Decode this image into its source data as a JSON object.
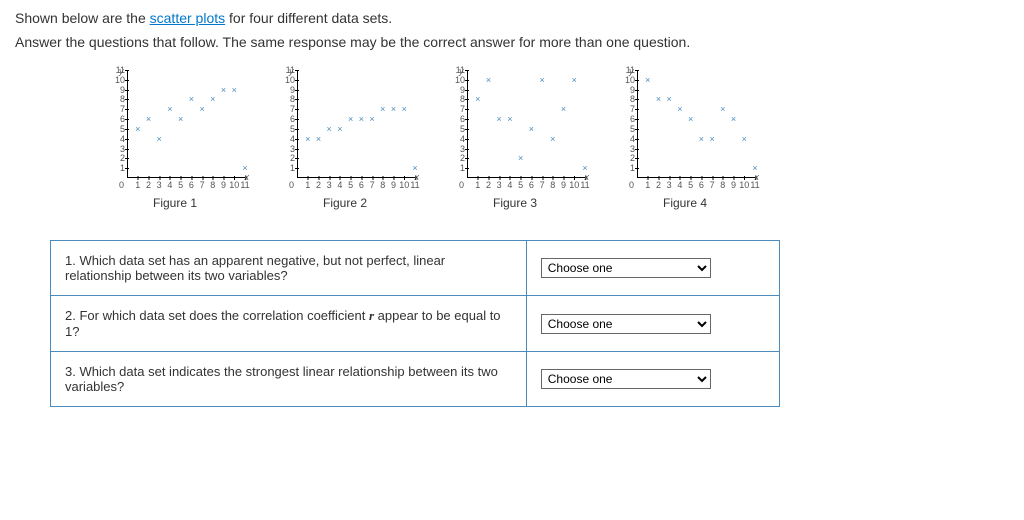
{
  "intro": {
    "line1_a": "Shown below are the ",
    "link": "scatter plots",
    "line1_b": " for four different data sets.",
    "line2": "Answer the questions that follow. The same response may be the correct answer for more than one question."
  },
  "chart_labels": {
    "y": "y",
    "x": "x",
    "origin": "0"
  },
  "y_ticks": [
    "1",
    "2",
    "3",
    "4",
    "5",
    "6",
    "7",
    "8",
    "9",
    "10",
    "11"
  ],
  "x_ticks": [
    "1",
    "2",
    "3",
    "4",
    "5",
    "6",
    "7",
    "8",
    "9",
    "10",
    "11"
  ],
  "chart_data": [
    {
      "type": "scatter",
      "label": "Figure 1",
      "title": "",
      "xlabel": "x",
      "ylabel": "y",
      "xlim": [
        0,
        11
      ],
      "ylim": [
        0,
        11
      ],
      "x": [
        1,
        2,
        3,
        4,
        5,
        6,
        7,
        8,
        9,
        10,
        11
      ],
      "y": [
        5,
        6,
        4,
        7,
        6,
        8,
        7,
        8,
        9,
        9,
        1
      ]
    },
    {
      "type": "scatter",
      "label": "Figure 2",
      "title": "",
      "xlabel": "x",
      "ylabel": "y",
      "xlim": [
        0,
        11
      ],
      "ylim": [
        0,
        11
      ],
      "x": [
        1,
        2,
        3,
        4,
        5,
        6,
        7,
        8,
        9,
        10,
        11
      ],
      "y": [
        4,
        4,
        5,
        5,
        6,
        6,
        6,
        7,
        7,
        7,
        1
      ]
    },
    {
      "type": "scatter",
      "label": "Figure 3",
      "title": "",
      "xlabel": "x",
      "ylabel": "y",
      "xlim": [
        0,
        11
      ],
      "ylim": [
        0,
        11
      ],
      "x": [
        1,
        2,
        3,
        4,
        5,
        6,
        7,
        8,
        9,
        10,
        11
      ],
      "y": [
        8,
        10,
        6,
        6,
        2,
        5,
        10,
        4,
        7,
        10,
        1
      ]
    },
    {
      "type": "scatter",
      "label": "Figure 4",
      "title": "",
      "xlabel": "x",
      "ylabel": "y",
      "xlim": [
        0,
        11
      ],
      "ylim": [
        0,
        11
      ],
      "x": [
        1,
        2,
        3,
        4,
        5,
        6,
        7,
        8,
        9,
        10,
        11
      ],
      "y": [
        10,
        8,
        8,
        7,
        6,
        4,
        4,
        7,
        6,
        4,
        1
      ]
    }
  ],
  "questions": [
    {
      "text": "1. Which data set has an apparent negative, but not perfect, linear relationship between its two variables?"
    },
    {
      "text_a": "2. For which data set does the correlation coefficient ",
      "italic": "r",
      "text_b": " appear to be equal to 1?"
    },
    {
      "text": "3. Which data set indicates the strongest linear relationship between its two variables?"
    }
  ],
  "dropdown": {
    "placeholder": "Choose one"
  }
}
